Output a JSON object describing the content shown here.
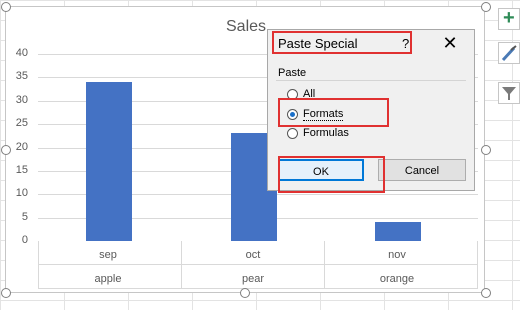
{
  "chart": {
    "title": "Sales",
    "y_ticks": [
      "40",
      "35",
      "30",
      "25",
      "20",
      "15",
      "10",
      "5",
      "0"
    ],
    "months": [
      "sep",
      "oct",
      "nov"
    ],
    "products": [
      "apple",
      "pear",
      "orange"
    ]
  },
  "chart_data": {
    "type": "bar",
    "title": "Sales",
    "categories": [
      "sep / apple",
      "oct / pear",
      "nov / orange"
    ],
    "values": [
      34,
      23,
      4
    ],
    "ylim": [
      0,
      40
    ],
    "bar_color": "#4472c4"
  },
  "dialog": {
    "title": "Paste Special",
    "help": "?",
    "close": "✕",
    "group": "Paste",
    "options": [
      {
        "label": "All",
        "selected": false
      },
      {
        "label": "Formats",
        "selected": true
      },
      {
        "label": "Formulas",
        "selected": false
      }
    ],
    "ok_label": "OK",
    "cancel_label": "Cancel"
  },
  "side_buttons": {
    "icons": [
      "plus-icon",
      "brush-icon",
      "filter-icon"
    ],
    "plus_glyph": "+",
    "accent": "#2e8b57"
  }
}
